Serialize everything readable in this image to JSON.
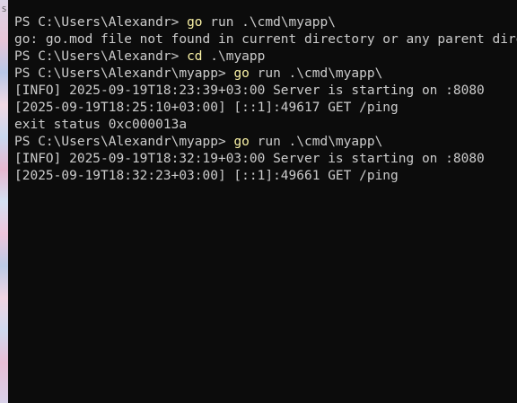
{
  "background_strip": {
    "glyph": "S"
  },
  "terminal": {
    "lines": [
      {
        "kind": "prompt",
        "prompt": "PS C:\\Users\\Alexandr> ",
        "cmd": "go",
        "args": " run .\\cmd\\myapp\\"
      },
      {
        "kind": "output",
        "text": "go: go.mod file not found in current directory or any parent directory"
      },
      {
        "kind": "prompt",
        "prompt": "PS C:\\Users\\Alexandr> ",
        "cmd": "cd",
        "args": " .\\myapp"
      },
      {
        "kind": "prompt",
        "prompt": "PS C:\\Users\\Alexandr\\myapp> ",
        "cmd": "go",
        "args": " run .\\cmd\\myapp\\"
      },
      {
        "kind": "output",
        "text": "[INFO] 2025-09-19T18:23:39+03:00 Server is starting on :8080"
      },
      {
        "kind": "output",
        "text": "[2025-09-19T18:25:10+03:00] [::1]:49617 GET /ping"
      },
      {
        "kind": "output",
        "text": "exit status 0xc000013a"
      },
      {
        "kind": "prompt",
        "prompt": "PS C:\\Users\\Alexandr\\myapp> ",
        "cmd": "go",
        "args": " run .\\cmd\\myapp\\"
      },
      {
        "kind": "output",
        "text": "[INFO] 2025-09-19T18:32:19+03:00 Server is starting on :8080"
      },
      {
        "kind": "output",
        "text": "[2025-09-19T18:32:23+03:00] [::1]:49661 GET /ping"
      }
    ]
  },
  "colors": {
    "background": "#0c0c0c",
    "text": "#cccccc",
    "command": "#f9f1a5"
  }
}
